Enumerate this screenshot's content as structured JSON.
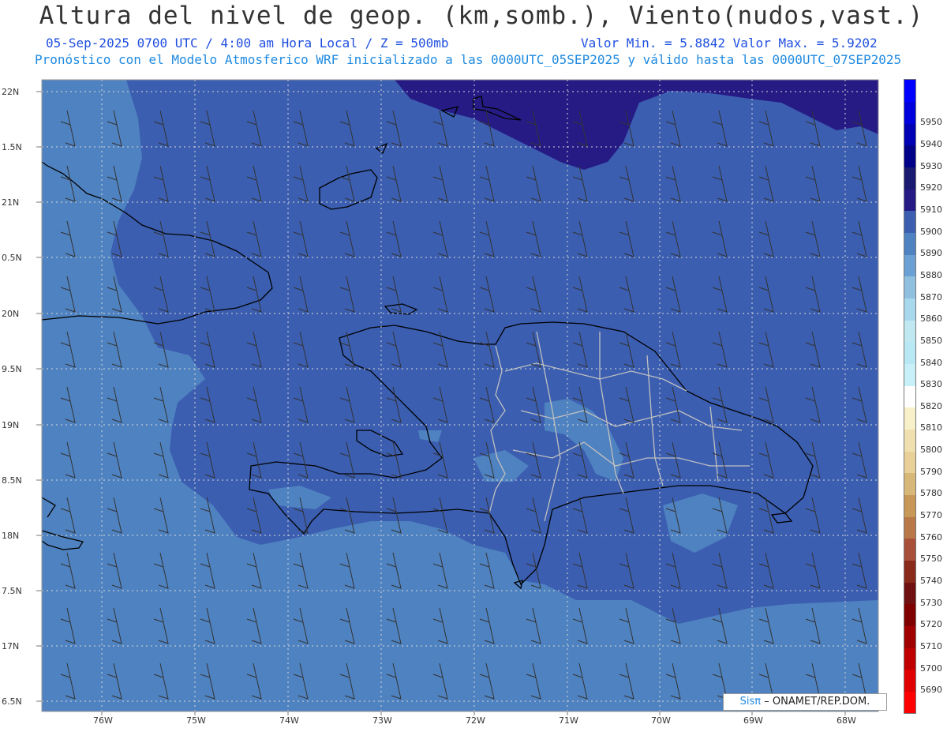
{
  "title": "Altura del nivel de geop. (km,somb.), Viento(nudos,vast.)",
  "subtitle_left": "05-Sep-2025  0700 UTC / 4:00 am Hora Local / Z = 500mb",
  "subtitle_right": "Valor Min. = 5.8842  Valor Max. = 5.9202",
  "subtitle_model": "Pronóstico con el Modelo Atmosferico WRF inicializado a las 0000UTC_05SEP2025 y válido hasta las  0000UTC_07SEP2025",
  "credit": {
    "brand": "Sisπ",
    "text": "– ONAMET/REP.DOM."
  },
  "map": {
    "lat_labels": [
      "22N",
      "1.5N",
      "21N",
      "0.5N",
      "20N",
      "9.5N",
      "19N",
      "8.5N",
      "18N",
      "7.5N",
      "17N",
      "6.5N"
    ],
    "lon_labels": [
      "76W",
      "75W",
      "74W",
      "73W",
      "72W",
      "71W",
      "70W",
      "69W",
      "68W"
    ],
    "colors": {
      "sea_light": "#4f82c0",
      "mid": "#3b5eb0",
      "high": "#261b85",
      "land_outline": "#000000",
      "province_border": "#c0c0c0"
    }
  },
  "colorbar": {
    "levels": [
      "5690",
      "5700",
      "5710",
      "5720",
      "5730",
      "5740",
      "5750",
      "5760",
      "5770",
      "5780",
      "5790",
      "5800",
      "5810",
      "5820",
      "5830",
      "5840",
      "5850",
      "5860",
      "5870",
      "5880",
      "5890",
      "5900",
      "5910",
      "5920",
      "5930",
      "5940",
      "5950"
    ],
    "colors": [
      "#ff0000",
      "#e00000",
      "#c00000",
      "#a00000",
      "#800000",
      "#701010",
      "#8a2a1a",
      "#a8503a",
      "#b87848",
      "#c89858",
      "#d8b878",
      "#e8d098",
      "#f0e0b0",
      "#f8f0c8",
      "#ffffff",
      "#c8f0f8",
      "#b8e8f4",
      "#c0e8f0",
      "#a8d8ec",
      "#90c0e0",
      "#6aa0d4",
      "#4f82c0",
      "#3b5eb0",
      "#261b85",
      "#1a1a70",
      "#000088",
      "#0000b4",
      "#0000dd",
      "#0000ff"
    ]
  }
}
